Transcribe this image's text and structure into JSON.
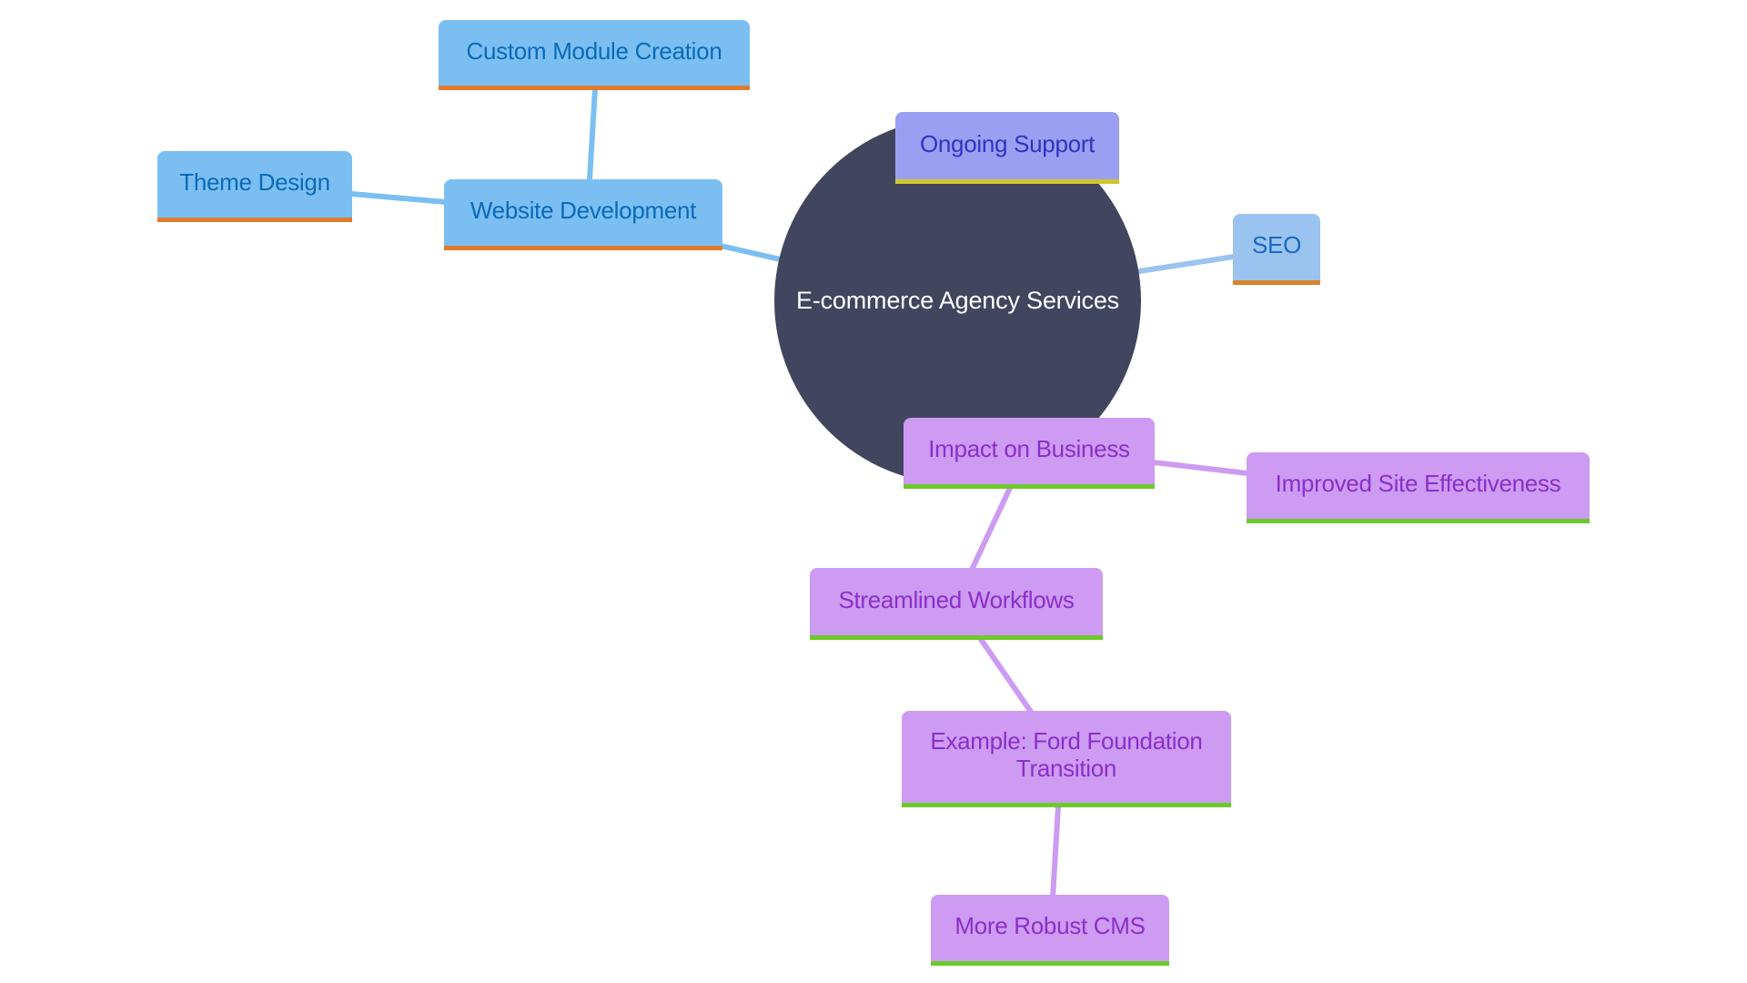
{
  "diagram": {
    "type": "mindmap",
    "root": {
      "id": "root",
      "label": "E-commerce Agency Services",
      "color": "#41455e",
      "text_color": "#ffffff"
    },
    "nodes": [
      {
        "id": "webdev",
        "label": "Website Development",
        "parent": "root",
        "branch": "blue"
      },
      {
        "id": "custom",
        "label": "Custom Module Creation",
        "parent": "webdev",
        "branch": "blue"
      },
      {
        "id": "theme",
        "label": "Theme Design",
        "parent": "webdev",
        "branch": "blue"
      },
      {
        "id": "support",
        "label": "Ongoing Support",
        "parent": "root",
        "branch": "indigo"
      },
      {
        "id": "seo",
        "label": "SEO",
        "parent": "root",
        "branch": "seo"
      },
      {
        "id": "impact",
        "label": "Impact on Business",
        "parent": "root",
        "branch": "purple"
      },
      {
        "id": "improved",
        "label": "Improved Site Effectiveness",
        "parent": "impact",
        "branch": "purple"
      },
      {
        "id": "stream",
        "label": "Streamlined Workflows",
        "parent": "impact",
        "branch": "purple"
      },
      {
        "id": "example",
        "label": "Example: Ford Foundation Transition",
        "parent": "stream",
        "branch": "purple"
      },
      {
        "id": "cms",
        "label": "More Robust CMS",
        "parent": "example",
        "branch": "purple"
      }
    ],
    "branch_colors": {
      "blue": {
        "fill": "#7bbff2",
        "text": "#0a6ab8",
        "underline": "#e07b2e",
        "edge": "#7bbff2"
      },
      "seo": {
        "fill": "#9bc3ef",
        "text": "#1769c2",
        "underline": "#d98428",
        "edge": "#9bc3ef"
      },
      "indigo": {
        "fill": "#9b9ff2",
        "text": "#2e35c2",
        "underline": "#d2c52b",
        "edge": "#9b9ff2"
      },
      "purple": {
        "fill": "#cd9bf2",
        "text": "#8a2fca",
        "underline": "#6cca2a",
        "edge": "#cd9bf2"
      }
    }
  },
  "labels": {
    "root": "E-commerce Agency Services",
    "webdev": "Website Development",
    "custom": "Custom Module Creation",
    "theme": "Theme Design",
    "support": "Ongoing Support",
    "seo": "SEO",
    "impact": "Impact on Business",
    "improved": "Improved Site Effectiveness",
    "stream": "Streamlined Workflows",
    "example": "Example: Ford Foundation Transition",
    "cms": "More Robust CMS"
  }
}
